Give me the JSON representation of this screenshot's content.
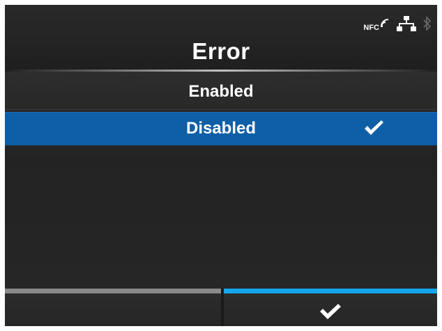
{
  "status_bar": {
    "nfc_label": "NFC",
    "icons": [
      "nfc-icon",
      "network-icon",
      "bluetooth-icon"
    ]
  },
  "header": {
    "title": "Error"
  },
  "options": [
    {
      "label": "Enabled",
      "selected": false
    },
    {
      "label": "Disabled",
      "selected": true
    }
  ],
  "softkeys": {
    "left": {
      "label": "",
      "indicator_color": "#8a8a8a"
    },
    "right": {
      "icon": "check-icon",
      "indicator_color": "#16a6ec"
    }
  },
  "colors": {
    "background": "#252525",
    "selection": "#0e5fa6",
    "accent": "#16a6ec",
    "text": "#ffffff"
  }
}
